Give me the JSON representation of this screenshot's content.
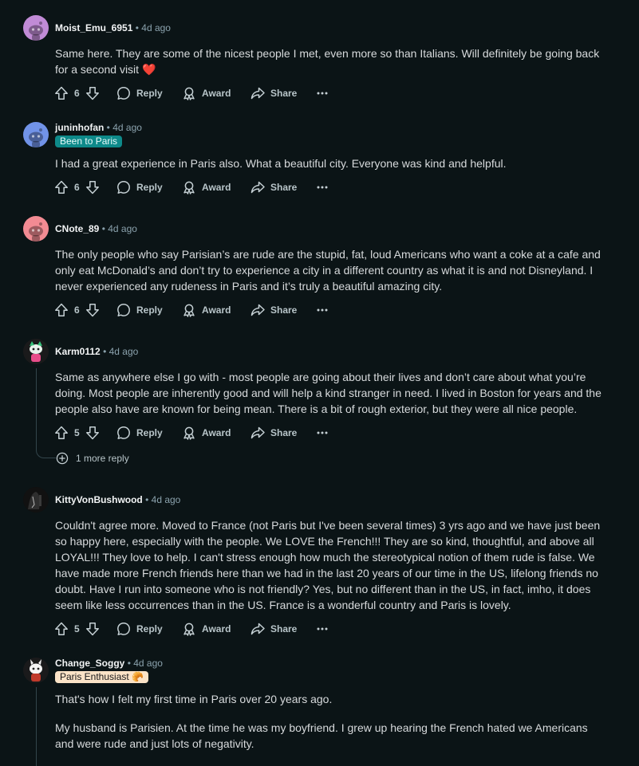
{
  "comments": [
    {
      "author": "Moist_Emu_6951",
      "time": "4d ago",
      "avatar_color": "#c18bd6",
      "avatar_icon": "snoo-avatar-icon",
      "body": [
        "Same here. They are some of the nicest people I met, even more so than Italians. Will definitely be going back for a second visit ❤️"
      ],
      "votes": "6",
      "reply": "Reply",
      "award": "Award",
      "share": "Share",
      "more": "···"
    },
    {
      "author": "juninhofan",
      "time": "4d ago",
      "avatar_color": "#7193e8",
      "avatar_icon": "snoo-avatar-icon",
      "flair": "Been to Paris",
      "flair_color": "#0e8a8a",
      "body": [
        "I had a great experience in Paris also. What a beautiful city. Everyone was kind and helpful."
      ],
      "votes": "6",
      "reply": "Reply",
      "award": "Award",
      "share": "Share",
      "more": "···"
    },
    {
      "author": "CNote_89",
      "time": "4d ago",
      "avatar_color": "#f28b93",
      "avatar_icon": "snoo-avatar-icon",
      "body": [
        "The only people who say Parisian’s are rude are the stupid, fat, loud Americans who want a coke at a cafe and only eat McDonald’s and don’t try to experience a city in a different country as what it is and not Disneyland. I never experienced any rudeness in Paris and it’s truly a beautiful amazing city."
      ],
      "votes": "6",
      "reply": "Reply",
      "award": "Award",
      "share": "Share",
      "more": "···"
    },
    {
      "author": "Karm0112",
      "time": "4d ago",
      "avatar_color": "#1a1a1b",
      "avatar_icon": "custom-avatar-icon",
      "body": [
        "Same as anywhere else I go with - most people are going about their lives and don’t care about what you’re doing. Most people are inherently good and will help a kind stranger in need. I lived in Boston for years and the people also have are known for being mean. There is a bit of rough exterior, but they were all nice people."
      ],
      "votes": "5",
      "reply": "Reply",
      "award": "Award",
      "share": "Share",
      "more": "···",
      "more_replies": "1 more reply"
    },
    {
      "author": "KittyVonBushwood",
      "time": "4d ago",
      "avatar_color": "#111111",
      "avatar_icon": "custom-avatar-icon",
      "body": [
        "Couldn't agree more. Moved to France (not Paris but I've been several times) 3 yrs ago and we have just been so happy here, especially with the people. We LOVE the French!!! They are so kind, thoughtful, and above all LOYAL!!! They love to help. I can't stress enough how much the stereotypical notion of them rude is false. We have made more French friends here than we had in the last 20 years of our time in the US, lifelong friends no doubt. Have I run into someone who is not friendly? Yes, but no different than in the US, in fact, imho, it does seem like less occurrences than in the US. France is a wonderful country and Paris is lovely."
      ],
      "votes": "5",
      "reply": "Reply",
      "award": "Award",
      "share": "Share",
      "more": "···"
    },
    {
      "author": "Change_Soggy",
      "time": "4d ago",
      "avatar_color": "#1a1a1b",
      "avatar_icon": "custom-avatar-icon",
      "flair": "Paris Enthusiast 🥐",
      "flair_color": "#fbe3c7",
      "body": [
        "That's how I felt my first time in Paris over 20 years ago.",
        "My husband is Parisien. At the time he was my boyfriend. I grew up hearing the French hated we Americans and were rude and just lots of negativity."
      ]
    }
  ],
  "separator": "•",
  "icons": {
    "upvote": "upvote-icon",
    "downvote": "downvote-icon",
    "reply": "comment-bubble-icon",
    "award": "award-icon",
    "share": "share-icon",
    "more": "more-options-icon",
    "expand": "plus-circle-icon"
  }
}
